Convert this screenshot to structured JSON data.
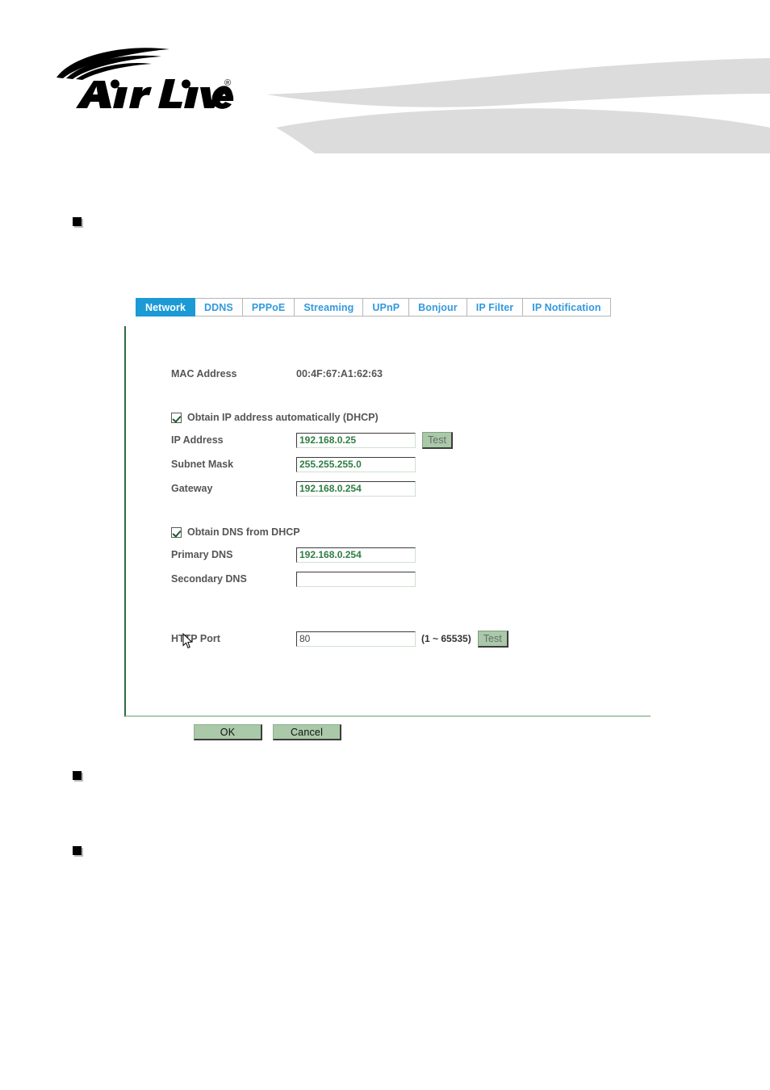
{
  "header": {
    "brand_name": "AirLive",
    "brand_trademark": "®"
  },
  "tabs": [
    {
      "label": "Network",
      "active": true
    },
    {
      "label": "DDNS",
      "active": false
    },
    {
      "label": "PPPoE",
      "active": false
    },
    {
      "label": "Streaming",
      "active": false
    },
    {
      "label": "UPnP",
      "active": false
    },
    {
      "label": "Bonjour",
      "active": false
    },
    {
      "label": "IP Filter",
      "active": false
    },
    {
      "label": "IP Notification",
      "active": false
    }
  ],
  "form": {
    "mac_address_label": "MAC Address",
    "mac_address_value": "00:4F:67:A1:62:63",
    "dhcp_checkbox_label": "Obtain IP address automatically (DHCP)",
    "ip_address_label": "IP Address",
    "ip_address_value": "192.168.0.25",
    "subnet_mask_label": "Subnet Mask",
    "subnet_mask_value": "255.255.255.0",
    "gateway_label": "Gateway",
    "gateway_value": "192.168.0.254",
    "dns_checkbox_label": "Obtain DNS from DHCP",
    "primary_dns_label": "Primary DNS",
    "primary_dns_value": "192.168.0.254",
    "secondary_dns_label": "Secondary DNS",
    "secondary_dns_value": "",
    "http_port_label": "HTTP Port",
    "http_port_value": "80",
    "http_port_range": "(1 ~ 65535)",
    "test_button_label": "Test"
  },
  "actions": {
    "ok_label": "OK",
    "cancel_label": "Cancel"
  },
  "colors": {
    "active_tab": "#1b9ad6",
    "inactive_tab_text": "#3399dd",
    "input_text": "#2e7d43",
    "button_face": "#a9c9a9",
    "panel_border": "#2f6b43"
  }
}
